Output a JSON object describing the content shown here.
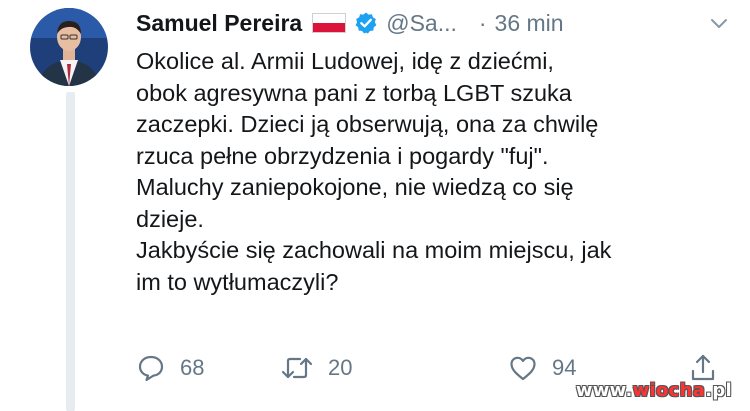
{
  "tweet": {
    "author_name": "Samuel Pereira",
    "handle": "@Sa...",
    "separator": "·",
    "time": "36 min",
    "flag": {
      "top_color": "#ffffff",
      "bottom_color": "#dc143c"
    },
    "verified_color": "#1da1f2",
    "lines": [
      "Okolice al. Armii Ludowej, idę z dziećmi,",
      "obok agresywna pani z torbą LGBT szuka",
      "zaczepki. Dzieci ją obserwują, ona za chwilę",
      "rzuca pełne obrzydzenia i pogardy \"fuj\".",
      "Maluchy zaniepokojone, nie wiedzą co się",
      "dzieje.",
      "Jakbyście się zachowali na moim miejscu, jak",
      "im to wytłumaczyli?"
    ]
  },
  "actions": {
    "reply_count": "68",
    "retweet_count": "20",
    "like_count": "94"
  },
  "icons": {
    "reply": "reply-icon",
    "retweet": "retweet-icon",
    "like": "heart-icon",
    "share": "share-icon",
    "menu": "chevron-down-icon"
  },
  "watermark": {
    "prefix": "www.",
    "brand": "wiocha",
    "suffix": ".pl"
  },
  "colors": {
    "text": "#14171a",
    "secondary": "#657786",
    "thread_line": "#e6ecf0"
  }
}
